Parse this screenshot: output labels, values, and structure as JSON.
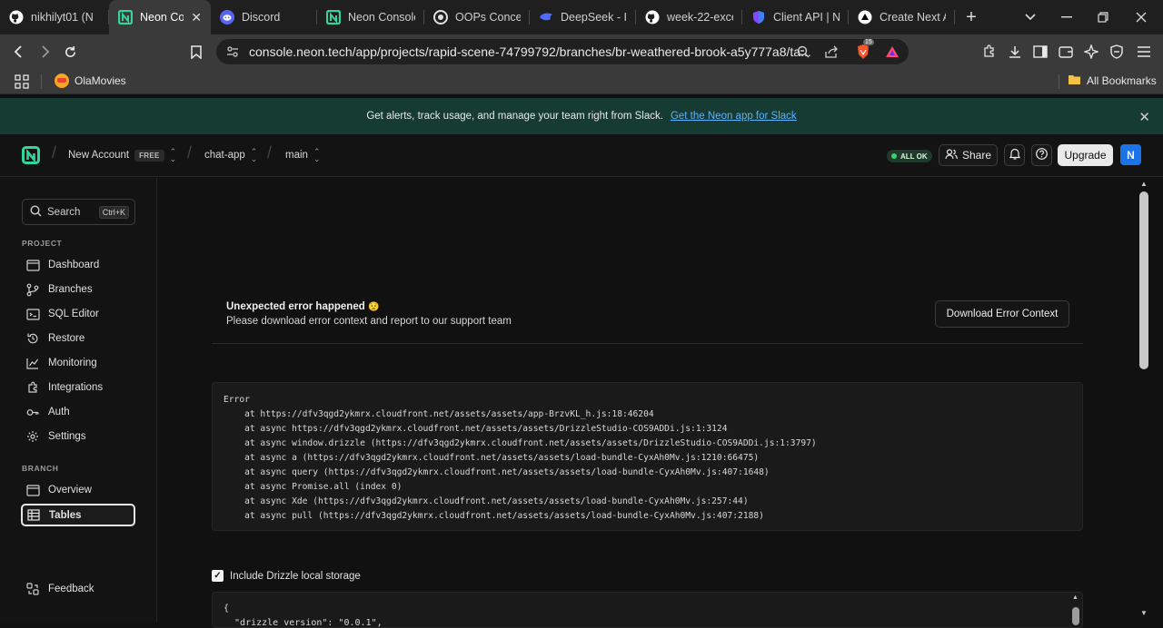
{
  "browser": {
    "tabs": [
      {
        "title": "nikhilyt01 (N",
        "icon": "github-icon",
        "active": false
      },
      {
        "title": "Neon Con",
        "icon": "neon-icon",
        "active": true
      },
      {
        "title": "Discord",
        "icon": "discord-icon",
        "active": false
      },
      {
        "title": "Neon Console",
        "icon": "neon-icon",
        "active": false
      },
      {
        "title": "OOPs Concep",
        "icon": "oops-icon",
        "active": false
      },
      {
        "title": "DeepSeek - In",
        "icon": "deepseek-icon",
        "active": false
      },
      {
        "title": "week-22-exce",
        "icon": "github-icon",
        "active": false
      },
      {
        "title": "Client API | Ne",
        "icon": "shield-icon",
        "active": false
      },
      {
        "title": "Create Next A",
        "icon": "triangle-icon",
        "active": false
      }
    ],
    "url": "console.neon.tech/app/projects/rapid-scene-74799792/branches/br-weathered-brook-a5y777a8/ta...",
    "brave_badge": "15",
    "bookmarks": [
      {
        "label": "OlaMovies"
      }
    ],
    "all_bookmarks_label": "All Bookmarks"
  },
  "banner": {
    "text": "Get alerts, track usage, and manage your team right from Slack.",
    "link": "Get the Neon app for Slack"
  },
  "header": {
    "account": "New Account",
    "plan": "FREE",
    "project": "chat-app",
    "branch": "main",
    "status": "ALL OK",
    "share_label": "Share",
    "upgrade_label": "Upgrade",
    "avatar_initial": "N"
  },
  "sidebar": {
    "search_label": "Search",
    "search_shortcut": "Ctrl+K",
    "project_heading": "PROJECT",
    "project_items": [
      {
        "label": "Dashboard",
        "icon": "dashboard-icon"
      },
      {
        "label": "Branches",
        "icon": "branches-icon"
      },
      {
        "label": "SQL Editor",
        "icon": "sql-editor-icon"
      },
      {
        "label": "Restore",
        "icon": "restore-icon"
      },
      {
        "label": "Monitoring",
        "icon": "monitoring-icon"
      },
      {
        "label": "Integrations",
        "icon": "integrations-icon"
      },
      {
        "label": "Auth",
        "icon": "auth-icon"
      },
      {
        "label": "Settings",
        "icon": "settings-icon"
      }
    ],
    "branch_heading": "BRANCH",
    "branch_items": [
      {
        "label": "Overview",
        "icon": "overview-icon",
        "active": false
      },
      {
        "label": "Tables",
        "icon": "tables-icon",
        "active": true
      }
    ],
    "feedback_label": "Feedback"
  },
  "main": {
    "error_title": "Unexpected error happened",
    "error_emoji": "😟",
    "error_subtitle": "Please download error context and report to our support team",
    "download_button": "Download Error Context",
    "stack_trace": [
      "Error",
      "    at https://dfv3qgd2ykmrx.cloudfront.net/assets/assets/app-BrzvKL_h.js:18:46204",
      "    at async https://dfv3qgd2ykmrx.cloudfront.net/assets/assets/DrizzleStudio-COS9ADDi.js:1:3124",
      "    at async window.drizzle (https://dfv3qgd2ykmrx.cloudfront.net/assets/assets/DrizzleStudio-COS9ADDi.js:1:3797)",
      "    at async a (https://dfv3qgd2ykmrx.cloudfront.net/assets/assets/load-bundle-CyxAh0Mv.js:1210:66475)",
      "    at async query (https://dfv3qgd2ykmrx.cloudfront.net/assets/assets/load-bundle-CyxAh0Mv.js:407:1648)",
      "    at async Promise.all (index 0)",
      "    at async Xde (https://dfv3qgd2ykmrx.cloudfront.net/assets/assets/load-bundle-CyxAh0Mv.js:257:44)",
      "    at async pull (https://dfv3qgd2ykmrx.cloudfront.net/assets/assets/load-bundle-CyxAh0Mv.js:407:2188)"
    ],
    "include_storage_label": "Include Drizzle local storage",
    "include_storage_checked": true,
    "json_preview": [
      "{",
      "  \"drizzle_version\": \"0.0.1\","
    ]
  },
  "colors": {
    "banner_bg": "#163b33",
    "link": "#5ab2ff",
    "neon_green": "#34d59a",
    "status_green": "#39d26a",
    "avatar_blue": "#1a73e8",
    "page_bg": "#111111"
  }
}
